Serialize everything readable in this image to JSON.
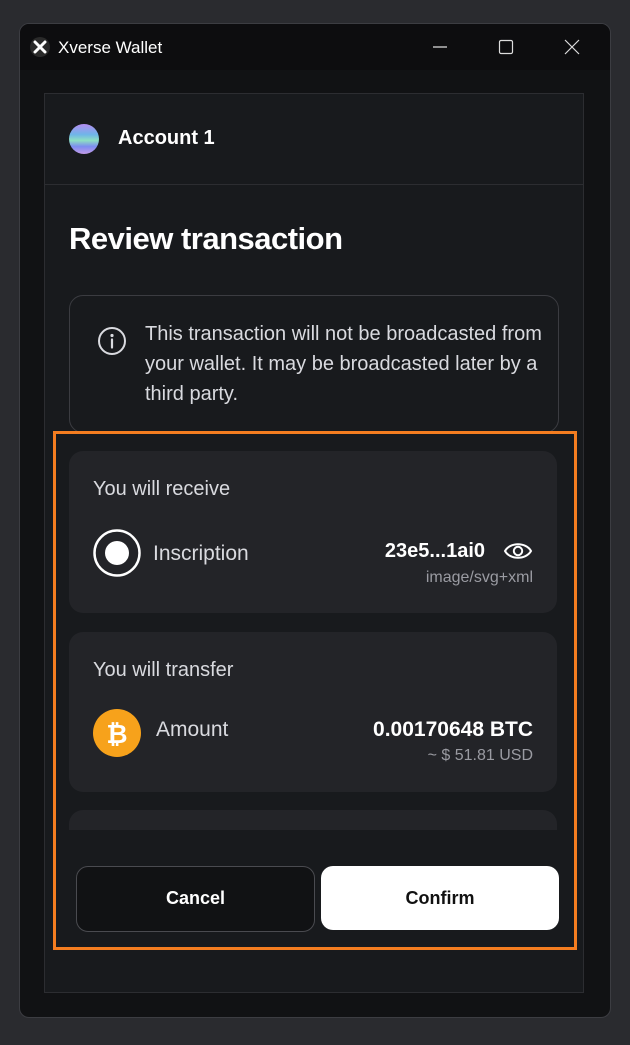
{
  "window": {
    "title": "Xverse Wallet"
  },
  "account": {
    "name": "Account 1"
  },
  "page": {
    "title": "Review transaction"
  },
  "notice": {
    "text": "This transaction will not be broadcasted from your wallet. It may be broadcasted later by a third party."
  },
  "receive": {
    "title": "You will receive",
    "item_label": "Inscription",
    "inscription_id": "23e5...1ai0",
    "content_type": "image/svg+xml"
  },
  "transfer": {
    "title": "You will transfer",
    "item_label": "Amount",
    "amount": "0.00170648 BTC",
    "usd": "~ $ 51.81 USD"
  },
  "actions": {
    "cancel": "Cancel",
    "confirm": "Confirm"
  },
  "colors": {
    "accent_highlight": "#f47d20",
    "bitcoin": "#f7a21b",
    "background": "#181a1d"
  },
  "icons": [
    "xverse-logo-icon",
    "minimize-icon",
    "maximize-icon",
    "close-icon",
    "info-icon",
    "inscription-icon",
    "eye-icon",
    "bitcoin-icon"
  ]
}
